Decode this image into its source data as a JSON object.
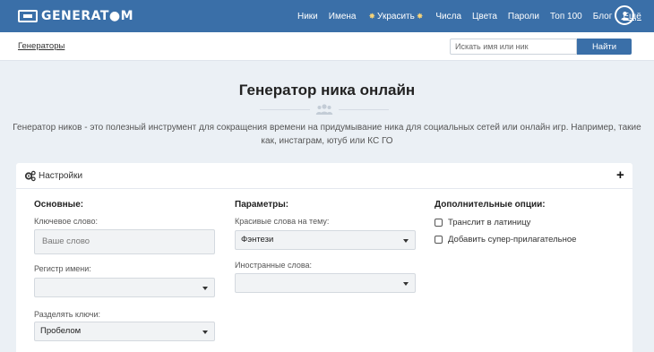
{
  "header": {
    "logo_text": "GENERAT●M",
    "nav": [
      {
        "label": "Ники"
      },
      {
        "label": "Имена"
      },
      {
        "label": "Украсить"
      },
      {
        "label": "Числа"
      },
      {
        "label": "Цвета"
      },
      {
        "label": "Пароли"
      },
      {
        "label": "Топ 100"
      },
      {
        "label": "Блог"
      },
      {
        "label": "Ещё"
      }
    ],
    "user_icon": "user-circle-icon"
  },
  "breadcrumb": {
    "label": "Генераторы"
  },
  "search": {
    "placeholder": "Искать имя или ник",
    "value": "",
    "button": "Найти"
  },
  "page": {
    "title": "Генератор ника онлайн",
    "intro": "Генератор ников - это полезный инструмент для сокращения времени на придумывание ника для социальных сетей или онлайн игр. Например, такие как, инстаграм, ютуб или КС ГО"
  },
  "settings": {
    "title": "Настройки",
    "columns": {
      "basic": {
        "heading": "Основные:",
        "keyword_label": "Ключевое слово:",
        "keyword_placeholder": "Ваше слово",
        "case_label": "Регистр имени:",
        "case_value": "",
        "separator_label": "Разделять ключи:",
        "separator_value": "Пробелом"
      },
      "params": {
        "heading": "Параметры:",
        "theme_label": "Красивые слова на тему:",
        "theme_value": "Фэнтези",
        "foreign_label": "Иностранные слова:",
        "foreign_value": ""
      },
      "extra": {
        "heading": "Дополнительные опции:",
        "options": [
          {
            "label": "Транслит в латиницу",
            "checked": false
          },
          {
            "label": "Добавить супер-прилагательное",
            "checked": false
          }
        ]
      }
    }
  },
  "colors": {
    "accent": "#3a6fa8",
    "background": "#ebf0f5"
  }
}
